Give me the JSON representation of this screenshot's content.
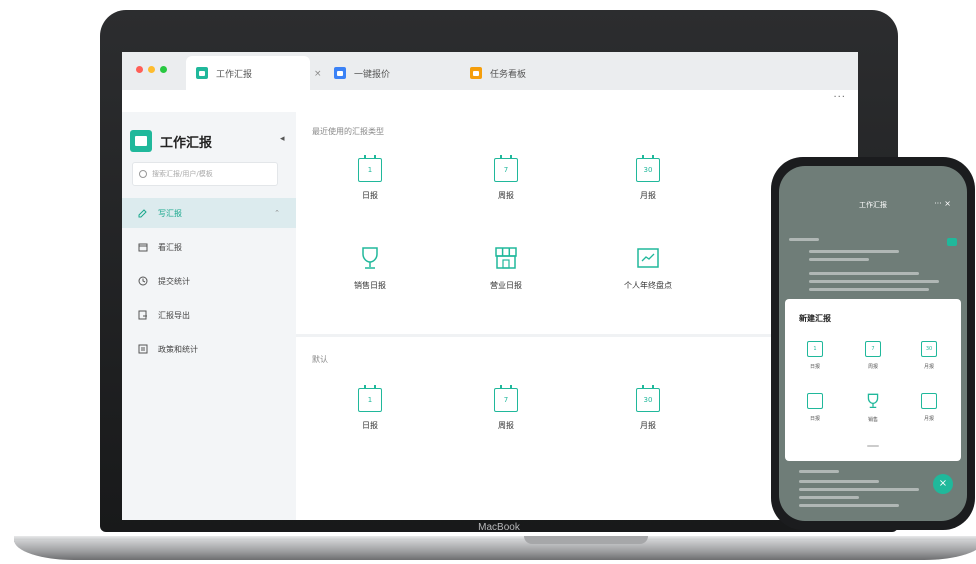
{
  "browser": {
    "tabs": [
      {
        "label": "工作汇报",
        "color": "#20b89b",
        "active": true
      },
      {
        "label": "一键报价",
        "color": "#3b82f6",
        "active": false
      },
      {
        "label": "任务看板",
        "color": "#f59e0b",
        "active": false
      }
    ],
    "close_glyph": "×",
    "more_glyph": "···"
  },
  "sidebar": {
    "app_title": "工作汇报",
    "collapse_glyph": "◂",
    "search_placeholder": "搜索汇报/用户/模板",
    "items": [
      {
        "label": "写汇报",
        "icon": "edit-icon",
        "active": true,
        "chevron": "⌃"
      },
      {
        "label": "看汇报",
        "icon": "calendar-icon",
        "active": false
      },
      {
        "label": "提交统计",
        "icon": "clock-icon",
        "active": false
      },
      {
        "label": "汇报导出",
        "icon": "export-icon",
        "active": false
      },
      {
        "label": "政策和统计",
        "icon": "list-icon",
        "active": false
      }
    ]
  },
  "main": {
    "recent_title": "最近使用的汇报类型",
    "recent_cards": [
      {
        "label": "日报",
        "icon_text": "1",
        "icon": "calendar-day-icon"
      },
      {
        "label": "周报",
        "icon_text": "7",
        "icon": "calendar-week-icon"
      },
      {
        "label": "月报",
        "icon_text": "30",
        "icon": "calendar-month-icon"
      },
      {
        "label": "销售日报",
        "icon_text": "",
        "icon": "trophy-icon"
      },
      {
        "label": "营业日报",
        "icon_text": "",
        "icon": "store-icon"
      },
      {
        "label": "个人年终盘点",
        "icon_text": "",
        "icon": "chart-icon"
      }
    ],
    "default_title": "默认",
    "default_cards": [
      {
        "label": "日报",
        "icon_text": "1",
        "icon": "calendar-day-icon"
      },
      {
        "label": "周报",
        "icon_text": "7",
        "icon": "calendar-week-icon"
      },
      {
        "label": "月报",
        "icon_text": "30",
        "icon": "calendar-month-icon"
      }
    ]
  },
  "laptop": {
    "brand": "MacBook"
  },
  "phone": {
    "title": "工作汇报",
    "sheet_title": "新建汇报",
    "items": [
      {
        "icon_text": "1",
        "label": "日报"
      },
      {
        "icon_text": "7",
        "label": "周报"
      },
      {
        "icon_text": "30",
        "label": "月报"
      },
      {
        "icon_text": "",
        "label": "日报"
      },
      {
        "icon_text": "",
        "label": "销售"
      },
      {
        "icon_text": "",
        "label": "月报"
      }
    ],
    "fab_glyph": "×"
  },
  "colors": {
    "accent": "#20b89b",
    "blue": "#3b82f6",
    "orange": "#f59e0b"
  }
}
